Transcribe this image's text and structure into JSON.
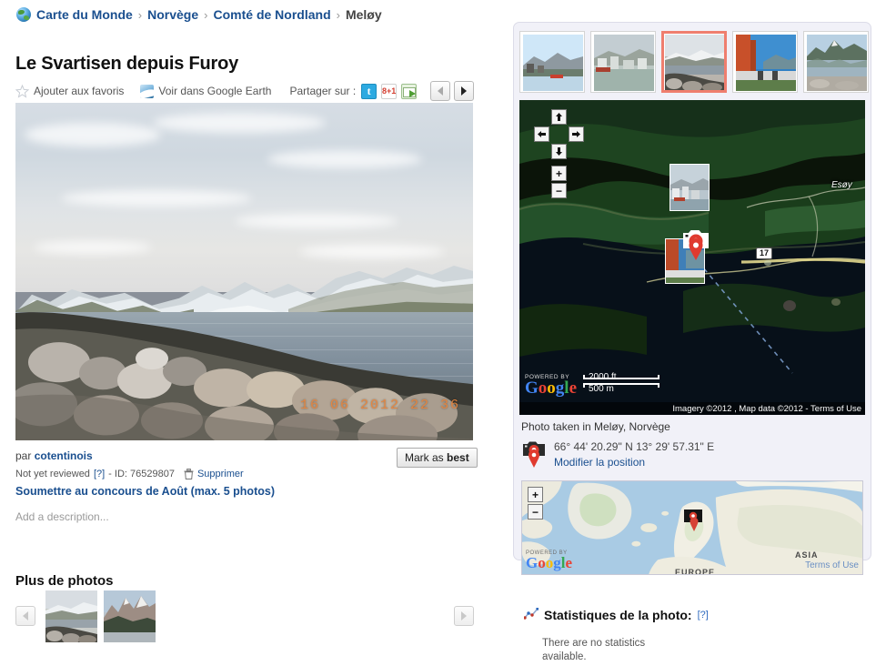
{
  "breadcrumb": {
    "icon": "globe-icon",
    "items": [
      "Carte du Monde",
      "Norvège",
      "Comté de Nordland",
      "Meløy"
    ],
    "separator": "›"
  },
  "photo": {
    "title": "Le Svartisen depuis Furoy",
    "timestamp_watermark": "16 06 2012 22 36",
    "author_prefix": "par",
    "author": "cotentinois",
    "review_status": "Not yet reviewed",
    "review_help": "[?]",
    "id_label": "- ID: 76529807",
    "delete_label": "Supprimer",
    "contest_link": "Soumettre au concours de Août (max. 5 photos)",
    "description_placeholder": "Add a description...",
    "mark_best_prefix": "Mark as ",
    "mark_best_strong": "best"
  },
  "actions": {
    "favorite": "Ajouter aux favoris",
    "google_earth": "Voir dans Google Earth",
    "share_label": "Partager sur :",
    "share_icons": [
      "twitter-icon",
      "google-plus-one-icon",
      "email-icon"
    ],
    "prev": "‹",
    "next": "›"
  },
  "more_photos": {
    "title": "Plus de photos",
    "prev": "‹",
    "next": "›",
    "count": 2
  },
  "map": {
    "scale_top": "2000 ft",
    "scale_bottom": "500 m",
    "attribution": "Imagery ©2012 , Map data ©2012 - Terms of Use",
    "google_powered_by": "POWERED BY",
    "google_word": "Google",
    "road_shield": "17",
    "island_label": "Esøy",
    "controls": {
      "up": "↑",
      "down": "↓",
      "left": "←",
      "right": "→",
      "zoom_in": "+",
      "zoom_out": "−"
    }
  },
  "location": {
    "taken_in": "Photo taken in Meløy, Norvège",
    "coordinates": "66° 44' 20.29\" N  13° 29' 57.31\" E",
    "edit_position": "Modifier la position"
  },
  "overview_map": {
    "zoom_in": "+",
    "zoom_out": "−",
    "terms": "Terms of Use",
    "google_powered_by": "POWERED BY",
    "google_word": "Google",
    "labels": [
      "ASIA",
      "EUROPE"
    ]
  },
  "statistics": {
    "heading": "Statistiques de la photo:",
    "help": "[?]",
    "body": "There are no statistics available."
  },
  "colors": {
    "link": "#1a4f8f",
    "panel_bg": "#f1f1f8",
    "selected_thumb_border": "#ef7e6e",
    "timestamp": "#e8843a"
  }
}
